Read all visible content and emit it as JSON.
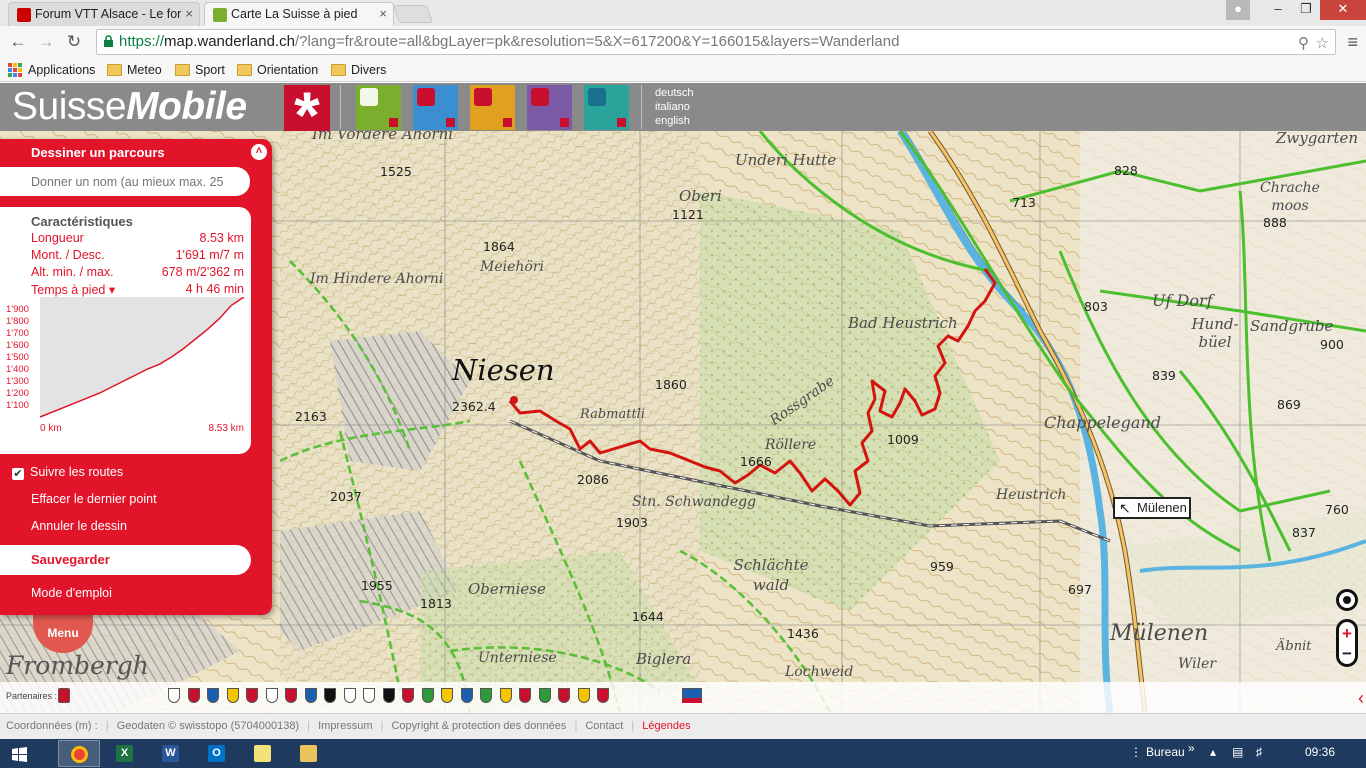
{
  "browser": {
    "tabs": [
      {
        "title": "Forum VTT Alsace - Le for",
        "active": false
      },
      {
        "title": "Carte La Suisse à pied",
        "active": true
      }
    ],
    "tab_close": "×",
    "url": {
      "scheme": "https://",
      "host": "map.wanderland.ch",
      "path": "/?lang=fr&route=all&bgLayer=pk&resolution=5&X=617200&Y=166015&layers=Wanderland"
    },
    "bookmarks": [
      "Applications",
      "Meteo",
      "Sport",
      "Orientation",
      "Divers"
    ]
  },
  "header": {
    "logo_regular": "Suisse",
    "logo_bold": "Mobile",
    "languages": [
      "deutsch",
      "italiano",
      "english"
    ],
    "sports": [
      {
        "icon": "hiking-icon",
        "color": "#7cae2e"
      },
      {
        "icon": "cycling-icon",
        "color": "#3b8fd1"
      },
      {
        "icon": "mountainbike-icon",
        "color": "#e0a11e"
      },
      {
        "icon": "skating-icon",
        "color": "#7c5aa6"
      },
      {
        "icon": "canoeing-icon",
        "color": "#2aa39a"
      }
    ]
  },
  "panel": {
    "title": "Dessiner un parcours",
    "name_placeholder": "Donner un nom (au mieux max. 25",
    "characteristics": {
      "heading": "Caractéristiques",
      "rows": [
        {
          "label": "Longueur",
          "value": "8.53 km"
        },
        {
          "label": "Mont. / Desc.",
          "value": "1'691 m/7 m"
        },
        {
          "label": "Alt. min. / max.",
          "value": "678 m/2'362 m"
        },
        {
          "label": "Temps à pied ▾",
          "value": "4 h 46 min"
        }
      ]
    },
    "follow_routes": "Suivre les routes",
    "follow_routes_checked": true,
    "links": [
      "Effacer le dernier point",
      "Annuler le dessin"
    ],
    "save": "Sauvegarder",
    "manual": "Mode d'emploi"
  },
  "chart_data": {
    "type": "area",
    "x_start_label": "0 km",
    "x_end_label": "8.53 km",
    "ytick_labels": [
      "1'900",
      "1'800",
      "1'700",
      "1'600",
      "1'500",
      "1'400",
      "1'300",
      "1'200",
      "1'100"
    ],
    "x": [
      0,
      0.5,
      1,
      1.5,
      2,
      2.5,
      3,
      3.5,
      4,
      4.5,
      5,
      5.5,
      6,
      6.5,
      7,
      7.5,
      8,
      8.53
    ],
    "y": [
      1000,
      1040,
      1080,
      1120,
      1160,
      1200,
      1250,
      1300,
      1350,
      1400,
      1440,
      1500,
      1570,
      1650,
      1730,
      1820,
      1930,
      2000
    ],
    "ylim": [
      1000,
      2000
    ],
    "xlim": [
      0,
      8.53
    ]
  },
  "map": {
    "place_labels": [
      {
        "text": "Im Vordere Ahorni"
      },
      {
        "text": "Meiehöri"
      },
      {
        "text": "Im Hindere Ahorni"
      },
      {
        "text": "Niesen"
      },
      {
        "text": "Rabmattli"
      },
      {
        "text": "Underi Hutte"
      },
      {
        "text": "Oberi"
      },
      {
        "text": "Bad Heustrich"
      },
      {
        "text": "Rossgrabe"
      },
      {
        "text": "Röllere"
      },
      {
        "text": "Heustrich"
      },
      {
        "text": "Chappelegand"
      },
      {
        "text": "Stn. Schwandegg"
      },
      {
        "text": "Schlächte wald"
      },
      {
        "text": "Oberniese"
      },
      {
        "text": "Unterniese"
      },
      {
        "text": "Biglera"
      },
      {
        "text": "Lochweid"
      },
      {
        "text": "Mülenen"
      },
      {
        "text": "Frombergh"
      },
      {
        "text": "Hund-büel"
      },
      {
        "text": "Uf Dorf"
      },
      {
        "text": "Sandgrube"
      },
      {
        "text": "Chrache moos"
      },
      {
        "text": "Zwygarten"
      },
      {
        "text": "Wiler"
      },
      {
        "text": "Äbnit"
      }
    ],
    "elevations": [
      "1525",
      "1864",
      "1121",
      "2362.4",
      "1860",
      "2163",
      "2086",
      "1666",
      "1009",
      "2037",
      "1903",
      "1955",
      "1813",
      "1644",
      "1436",
      "959",
      "828",
      "713",
      "888",
      "803",
      "839",
      "900",
      "869",
      "697",
      "760",
      "837"
    ],
    "signpost": "Mülenen",
    "menu_button": "Menu"
  },
  "partners_label": "Partenaires :",
  "footer": {
    "coordinates": "Coordonnées (m) :",
    "geodata": "Geodaten © swisstopo (5704000138)",
    "impressum": "Impressum",
    "copyright": "Copyright & protection des données",
    "contact": "Contact",
    "legend": "Légendes"
  },
  "taskbar": {
    "desktop_label": "Bureau",
    "time": "09:36"
  },
  "colors": {
    "brand_red": "#e2142a",
    "route_red": "#d4140f"
  }
}
